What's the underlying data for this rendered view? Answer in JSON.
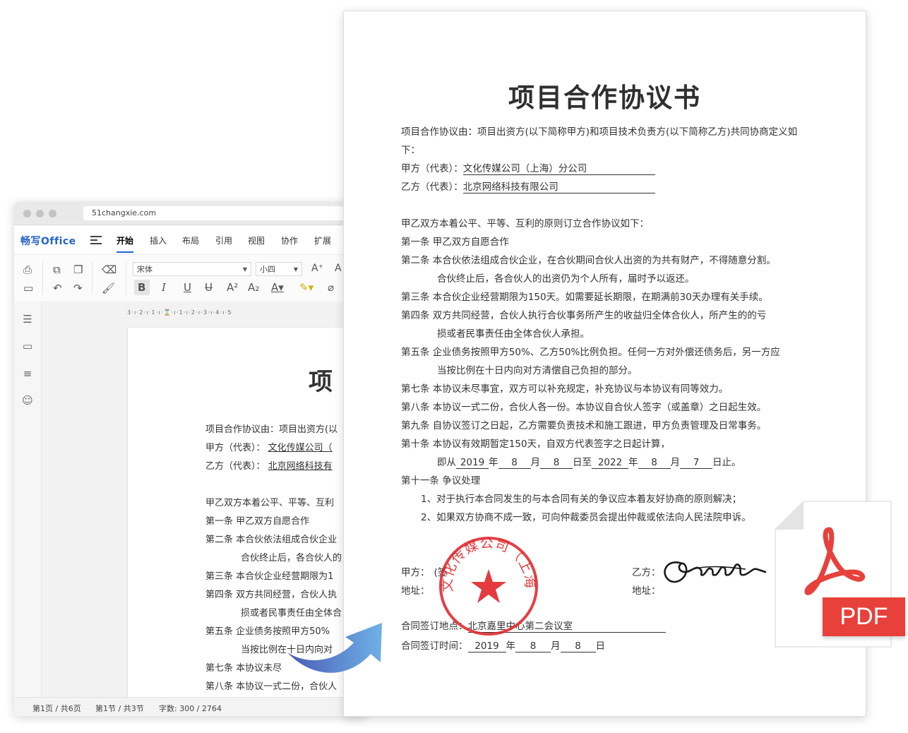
{
  "browser": {
    "url": "51changxie.com"
  },
  "app": {
    "logo": "畅写Office"
  },
  "menu": {
    "tabs": [
      "开始",
      "插入",
      "布局",
      "引用",
      "视图",
      "协作",
      "扩展"
    ]
  },
  "toolbar": {
    "font_name": "宋体",
    "font_size": "小四"
  },
  "ruler": {
    "text": "3·ı·2·ı·1·ı·⌛·ı·1·ı·2·ı·3·ı·4·ı·5"
  },
  "status": {
    "page": "第1页 / 共6页",
    "section": "第1节 / 共3节",
    "words": "字数:  300 / 2764"
  },
  "editor": {
    "title_visible": "项",
    "lines": [
      "项目合作协议由：项目出资方(以",
      "甲方（代表）：",
      "乙方（代表）：",
      "甲乙双方本着公平、平等、互利",
      "第一条  甲乙双方自愿合作",
      "第二条  本合伙依法组成合伙企业",
      "合伙终止后，各合伙人的",
      "第三条  本合伙企业经营期限为1",
      "第四条  双方共同经营，合伙人执",
      "损或者民事责任由全体合",
      "第五条  企业债务按照甲方50%",
      "当按比例在十日内向对",
      "第七条  本协议未尽",
      "第八条  本协议一式二份，合伙人"
    ],
    "party_a_value": "文化传媒公司（",
    "party_b_value": "北京网络科技有"
  },
  "document": {
    "title": "项目合作协议书",
    "intro_1": "项目合作协议由：项目出资方(以下简称甲方)和项目技术负责方(以下简称乙方)共同协商定义如",
    "intro_2": "下：",
    "party_a_label": "甲方（代表）：",
    "party_a_value": "文化传媒公司（上海）分公司",
    "party_b_label": "乙方（代表）：",
    "party_b_value": "北京网络科技有限公司",
    "preamble": "甲乙双方本着公平、平等、互利的原则订立合作协议如下：",
    "clauses": [
      "第一条  甲乙双方自愿合作",
      "第二条  本合伙依法组成合伙企业，在合伙期间合伙人出资的为共有财产，不得随意分割。",
      "合伙终止后，各合伙人的出资仍为个人所有，届时予以返还。",
      "第三条  本合伙企业经营期限为150天。如需要延长期限，在期满前30天办理有关手续。",
      "第四条  双方共同经营，合伙人执行合伙事务所产生的收益归全体合伙人，所产生的的亏",
      "损或者民事责任由全体合伙人承担。",
      "第五条  企业债务按照甲方50%、乙方50%比例负担。任何一方对外偿还债务后，另一方应",
      "当按比例在十日内向对方清偿自己负担的部分。",
      "第七条  本协议未尽事宜，双方可以补充规定，补充协议与本协议有同等效力。",
      "第八条  本协议一式二份，合伙人各一份。本协议自合伙人签字（或盖章）之日起生效。",
      "第九条  自协议签订之日起，乙方需要负责技术和施工跟进，甲方负责管理及日常事务。",
      "第十条  本协议有效期暂定150天，自双方代表签字之日起计算，"
    ],
    "period": {
      "prefix": "即从",
      "y1": "2019",
      "m1": "8",
      "d1": "8",
      "mid": "日至",
      "y2": "2022",
      "m2": "8",
      "d2": "7",
      "end": "日止。",
      "year": "年",
      "month": "月",
      "day": "日"
    },
    "clause_11": "第十一条  争议处理",
    "dispute_1": "1、对于执行本合同发生的与本合同有关的争议应本着友好协商的原则解决；",
    "dispute_2": "2、如果双方协商不成一致，可向仲裁委员会提出仲裁或依法向人民法院申诉。",
    "sign_a": "甲方：",
    "sign_a_hint": "(签",
    "address_a": "地址：",
    "sign_b": "乙方：",
    "address_b": "地址：",
    "place_label": "合同签订地点：",
    "place_value": "北京嘉里中心第二会议室",
    "time_label": "合同签订时间：",
    "sign_date": {
      "year": "2019",
      "month": "8",
      "day": "8"
    },
    "seal_text": "文化传媒公司（上海）分公司"
  },
  "pdf_badge": {
    "label": "PDF"
  },
  "colors": {
    "brand_blue": "#2563c9",
    "seal_red": "#e0262b",
    "pdf_red": "#e8413b"
  }
}
